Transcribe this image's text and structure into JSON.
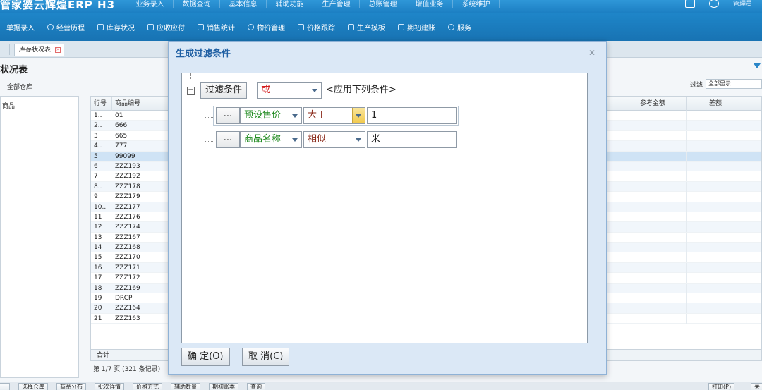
{
  "app": {
    "brand": "管家婆云辉煌ERP H3",
    "user": "管理员"
  },
  "topnav": [
    "业务录入",
    "数据查询",
    "基本信息",
    "辅助功能",
    "生产管理",
    "总账管理",
    "增值业务",
    "系统维护"
  ],
  "toolbar": [
    "单据录入",
    "经营历程",
    "库存状况",
    "应收应付",
    "销售统计",
    "物价管理",
    "价格跟踪",
    "生产模板",
    "期初建账",
    "服务"
  ],
  "tabs": {
    "active": "库存状况表"
  },
  "page": {
    "title": "状况表",
    "warehouse": "全部仓库",
    "left_header": "商品",
    "filter_label": "过滤",
    "filter_value": "全部显示",
    "columns": [
      "行号",
      "商品编号",
      "参考金额",
      "差额"
    ],
    "rows": [
      [
        "1..",
        "01"
      ],
      [
        "2..",
        "666"
      ],
      [
        "3",
        "665"
      ],
      [
        "4..",
        "777"
      ],
      [
        "5",
        "99099"
      ],
      [
        "6",
        "ZZZ193"
      ],
      [
        "7",
        "ZZZ192"
      ],
      [
        "8..",
        "ZZZ178"
      ],
      [
        "9",
        "ZZZ179"
      ],
      [
        "10..",
        "ZZZ177"
      ],
      [
        "11",
        "ZZZ176"
      ],
      [
        "12",
        "ZZZ174"
      ],
      [
        "13",
        "ZZZ167"
      ],
      [
        "14",
        "ZZZ168"
      ],
      [
        "15",
        "ZZZ170"
      ],
      [
        "16",
        "ZZZ171"
      ],
      [
        "17",
        "ZZZ172"
      ],
      [
        "18",
        "ZZZ169"
      ],
      [
        "19",
        "DRCP"
      ],
      [
        "20",
        "ZZZ164"
      ],
      [
        "21",
        "ZZZ163"
      ]
    ],
    "selected_row": 5,
    "total_label": "合计",
    "pager": "第 1/7 页 (321 条记录)"
  },
  "bottom_buttons": [
    "选择仓库",
    "商品分布",
    "批次详情",
    "价格方式",
    "辅助数量",
    "期初账本",
    "查询"
  ],
  "bottom_right": [
    "打印(P)",
    "关"
  ],
  "dialog": {
    "title": "生成过滤条件",
    "root_label": "过滤条件",
    "root_logic": "或",
    "root_note": "<应用下列条件>",
    "conditions": [
      {
        "dots": "...",
        "field": "预设售价",
        "op": "大于",
        "value": "1"
      },
      {
        "dots": "...",
        "field": "商品名称",
        "op": "相似",
        "value": "米"
      }
    ],
    "ok": "确 定(O)",
    "cancel": "取 消(C)"
  }
}
